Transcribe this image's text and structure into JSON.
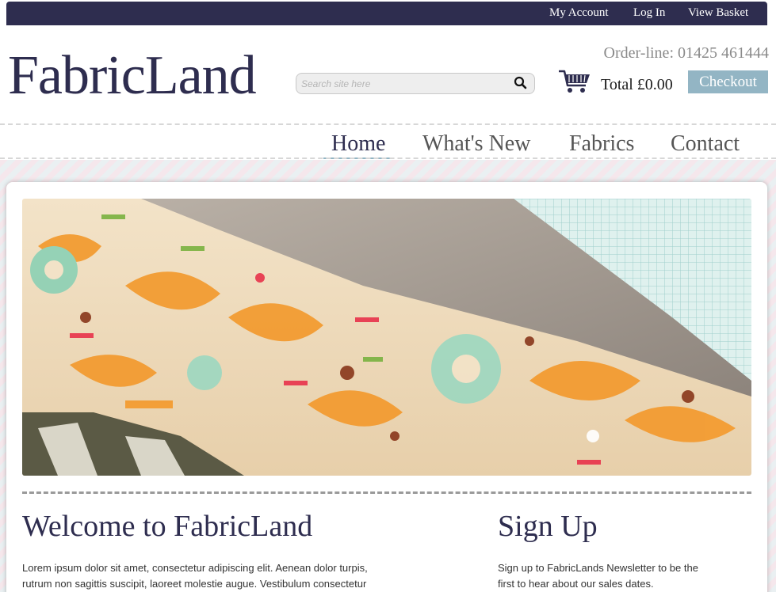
{
  "topbar": {
    "my_account": "My Account",
    "log_in": "Log In",
    "view_basket": "View Basket"
  },
  "header": {
    "logo": "FabricLand",
    "order_line": "Order-line: 01425 461444",
    "total": "Total £0.00",
    "checkout_label": "Checkout",
    "search": {
      "placeholder": "Search site here",
      "icon": "search-icon"
    },
    "cart_icon": "shopping-cart-icon"
  },
  "nav": {
    "items": [
      {
        "label": "Home",
        "active": true
      },
      {
        "label": "What's New",
        "active": false
      },
      {
        "label": "Fabrics",
        "active": false
      },
      {
        "label": "Contact",
        "active": false
      }
    ]
  },
  "main": {
    "welcome_title": "Welcome to FabricLand",
    "welcome_text_line1": "Lorem ipsum dolor sit amet, consectetur adipiscing elit. Aenean dolor turpis,",
    "welcome_text_line2": "rutrum non sagittis suscipit, laoreet molestie augue. Vestibulum consectetur",
    "signup_title": "Sign Up",
    "signup_text_line1": "Sign up to FabricLands Newsletter to be the",
    "signup_text_line2": "first to hear about our sales dates."
  },
  "colors": {
    "brand_navy": "#2e2d4f",
    "accent_blue": "#93b5c4"
  }
}
